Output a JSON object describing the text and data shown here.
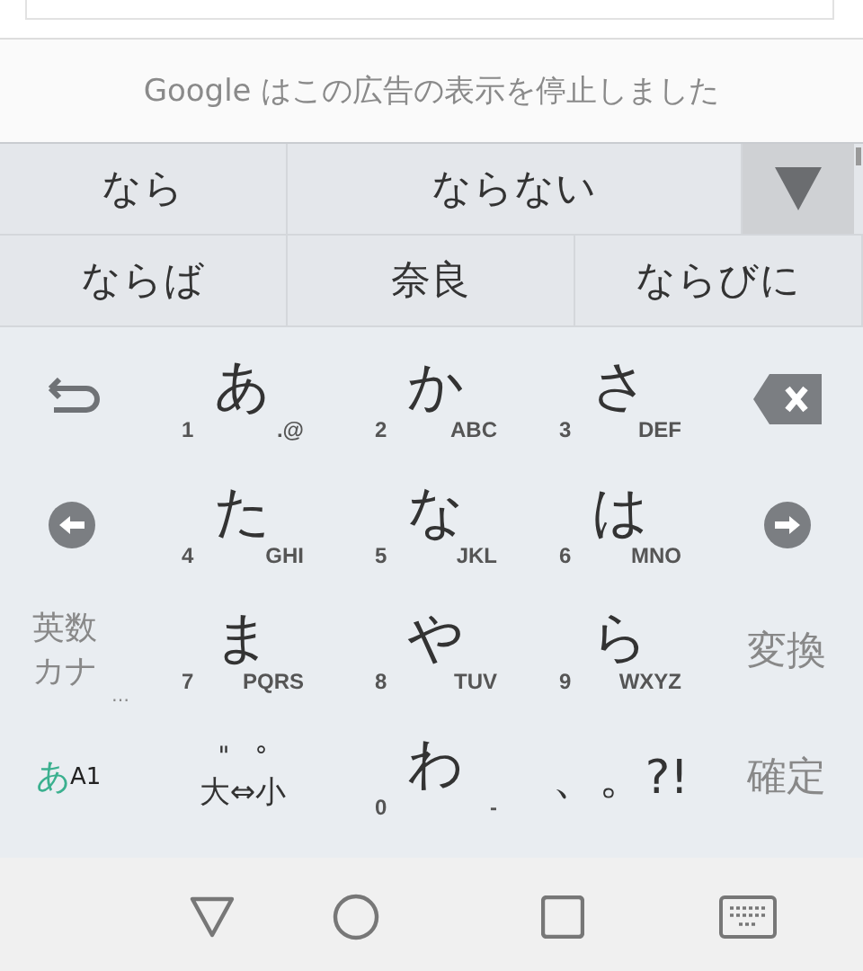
{
  "ad_notice": {
    "text": "Google はこの広告の表示を停止しました"
  },
  "candidate_rows": [
    {
      "items": [
        {
          "text": "なら"
        },
        {
          "text": "ならない"
        }
      ],
      "expand": true
    },
    {
      "items": [
        {
          "text": "ならば"
        },
        {
          "text": "奈良"
        },
        {
          "text": "ならびに"
        }
      ],
      "expand": false
    }
  ],
  "key_rows": [
    {
      "keys": [
        {
          "kind": "undo"
        },
        {
          "kind": "kana",
          "main": "あ",
          "number": "1",
          "letters": ".@"
        },
        {
          "kind": "kana",
          "main": "か",
          "number": "2",
          "letters": "ABC"
        },
        {
          "kind": "kana",
          "main": "さ",
          "number": "3",
          "letters": "DEF"
        },
        {
          "kind": "backspace"
        }
      ]
    },
    {
      "keys": [
        {
          "kind": "left"
        },
        {
          "kind": "kana",
          "main": "た",
          "number": "4",
          "letters": "GHI"
        },
        {
          "kind": "kana",
          "main": "な",
          "number": "5",
          "letters": "JKL"
        },
        {
          "kind": "kana",
          "main": "は",
          "number": "6",
          "letters": "MNO"
        },
        {
          "kind": "right"
        }
      ]
    },
    {
      "keys": [
        {
          "kind": "modes",
          "label": "英数カナ",
          "more": "…"
        },
        {
          "kind": "kana",
          "main": "ま",
          "number": "7",
          "letters": "PQRS"
        },
        {
          "kind": "kana",
          "main": "や",
          "number": "8",
          "letters": "TUV"
        },
        {
          "kind": "kana",
          "main": "ら",
          "number": "9",
          "letters": "WXYZ"
        },
        {
          "kind": "label",
          "label": "変換"
        }
      ]
    },
    {
      "keys": [
        {
          "kind": "mode",
          "main": "あ",
          "sub": "A1"
        },
        {
          "kind": "marks",
          "marks": [
            "\"",
            "°"
          ],
          "label": "大⇔小"
        },
        {
          "kind": "kana",
          "main": "わ",
          "number": "0",
          "letters": "-"
        },
        {
          "kind": "punct",
          "label": "、。?!"
        },
        {
          "kind": "label",
          "label": "確定"
        }
      ]
    }
  ]
}
